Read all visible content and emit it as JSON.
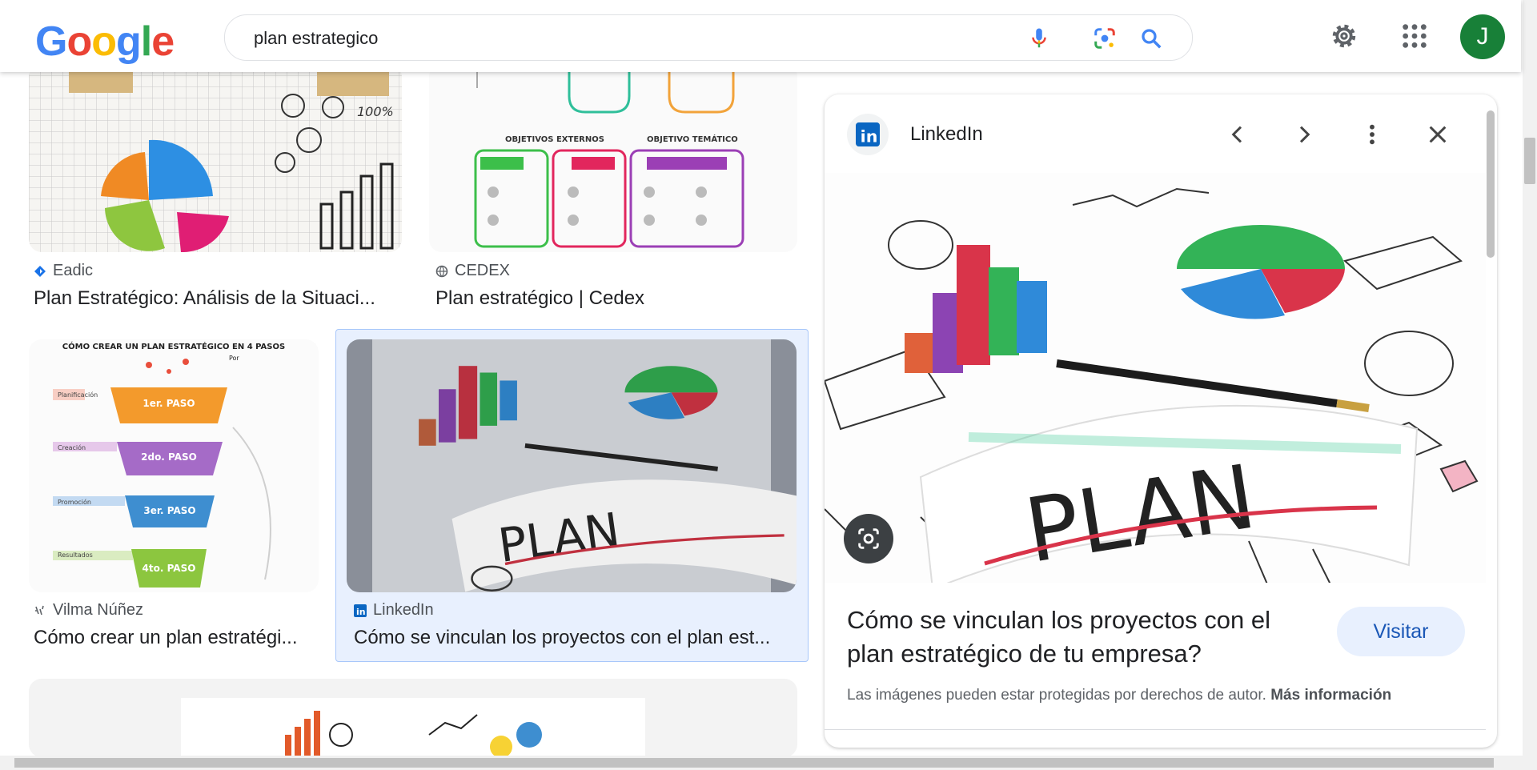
{
  "header": {
    "logo": "Google",
    "query": "plan estrategico"
  },
  "avatar_letter": "J",
  "results": [
    {
      "source": "Eadic",
      "title": "Plan Estratégico: Análisis de la Situaci..."
    },
    {
      "source": "CEDEX",
      "title": "Plan estratégico | Cedex"
    },
    {
      "source": "Vilma Núñez",
      "title": "Cómo crear un plan estratégi..."
    },
    {
      "source": "LinkedIn",
      "title": "Cómo se vinculan los proyectos con el plan est..."
    }
  ],
  "thumb_text": {
    "funnel_title": "CÓMO CREAR UN PLAN ESTRATÉGICO EN 4 PASOS",
    "funnel_author": "Por",
    "steps": [
      {
        "stage": "Planificación",
        "label": "1er. PASO"
      },
      {
        "stage": "Creación",
        "label": "2do. PASO"
      },
      {
        "stage": "Promoción",
        "label": "3er. PASO"
      },
      {
        "stage": "Resultados",
        "label": "4to. PASO"
      }
    ],
    "cedex_headings": [
      "OBJETIVOS EXTERNOS",
      "OBJETIVO TEMÁTICO"
    ],
    "plan_word": "PLAN"
  },
  "panel": {
    "source": "LinkedIn",
    "title": "Cómo se vinculan los proyectos con el plan estratégico de tu empresa?",
    "visit": "Visitar",
    "copyright": "Las imágenes pueden estar protegidas por derechos de autor.",
    "more_info": "Más información"
  },
  "colors": {
    "google_blue": "#4285F4",
    "google_red": "#EA4335",
    "google_yellow": "#FBBC05",
    "google_green": "#34A853",
    "linkedin": "#0a66c2",
    "selected_bg": "#e8f0fe"
  }
}
